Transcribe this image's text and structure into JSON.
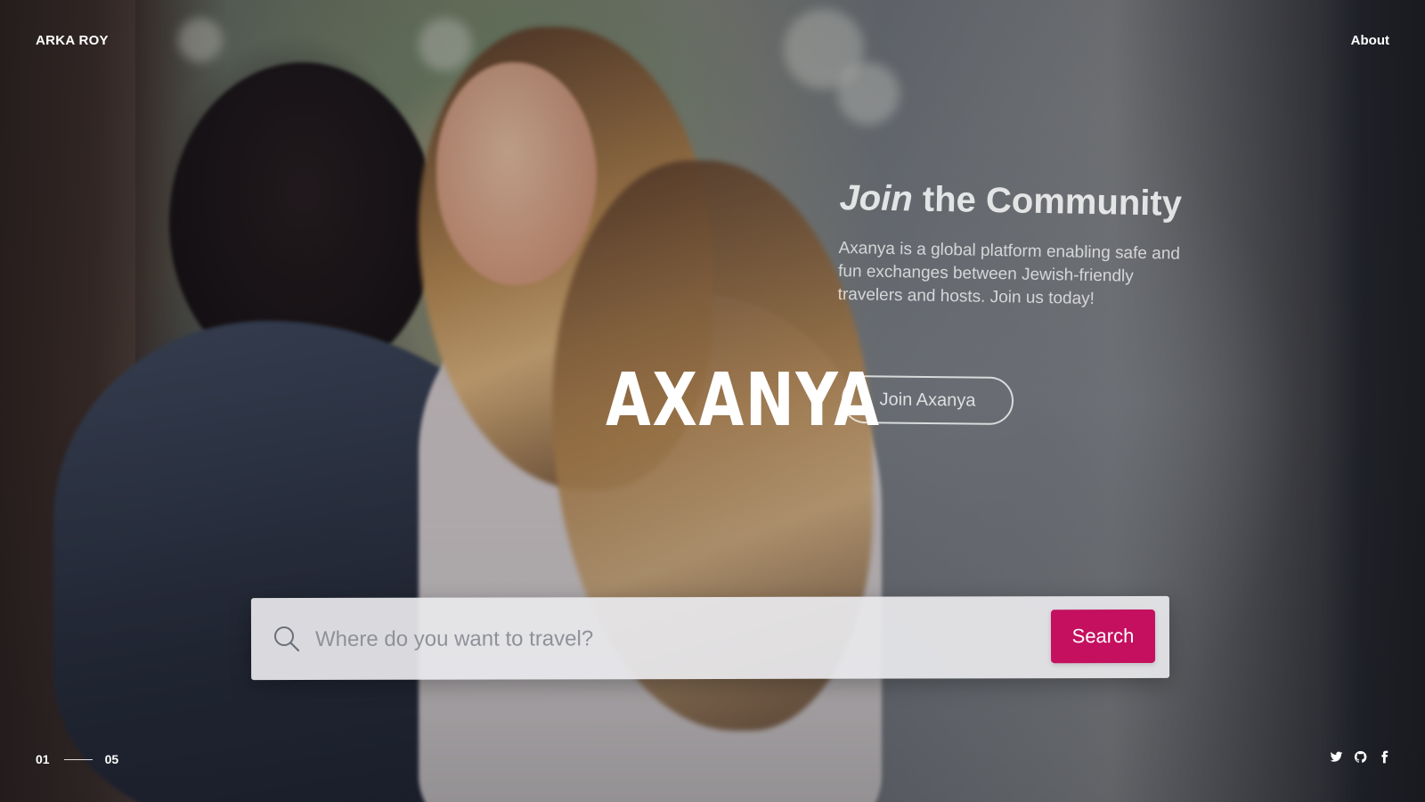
{
  "header": {
    "brand_name": "ARKA ROY",
    "nav_about": "About"
  },
  "hero": {
    "wordmark": "AXANYA",
    "community": {
      "title_italic": "Join",
      "title_rest": " the Community",
      "description": "Axanya is a global platform enabling safe and fun exchanges between Jewish-friendly travelers and hosts. Join us today!",
      "join_button": "Join Axanya"
    }
  },
  "search": {
    "placeholder": "Where do you want to travel?",
    "value": "",
    "button_label": "Search",
    "icon": "search-icon"
  },
  "pager": {
    "current": "01",
    "total": "05"
  },
  "social": {
    "icons": [
      "twitter-icon",
      "github-icon",
      "facebook-icon"
    ]
  },
  "colors": {
    "accent": "#c4105f",
    "text_light": "#ffffff",
    "search_bg": "#e8e8ec"
  }
}
